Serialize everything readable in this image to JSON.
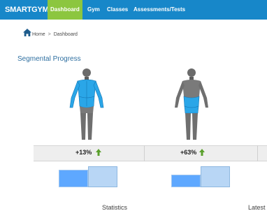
{
  "app": {
    "brand": "SMARTGYM"
  },
  "nav": {
    "tabs": [
      {
        "label": "Dashboard",
        "active": true
      },
      {
        "label": "Gym",
        "active": false
      },
      {
        "label": "Classes",
        "active": false
      },
      {
        "label": "Assessments/Tests",
        "active": false
      }
    ]
  },
  "breadcrumb": {
    "home": "Home",
    "separator": ">",
    "current": "Dashboard"
  },
  "section": {
    "title": "Segmental Progress"
  },
  "segments": [
    {
      "change": "+13%",
      "trend_icon": "up-arrow-icon",
      "bars": {
        "before": 0.62,
        "after": 0.75
      }
    },
    {
      "change": "+63%",
      "trend_icon": "up-arrow-icon",
      "bars": {
        "before": 0.45,
        "after": 0.75
      }
    }
  ],
  "footer": {
    "statistics": "Statistics",
    "latest": "Latest"
  },
  "colors": {
    "navbar": "#1787c9",
    "active_tab": "#8cc63f",
    "highlight_muscle": "#2aa6e8",
    "bar_before": "#5ea8ff",
    "bar_after": "#b8d6f5",
    "trend_up": "#5aa02c"
  }
}
